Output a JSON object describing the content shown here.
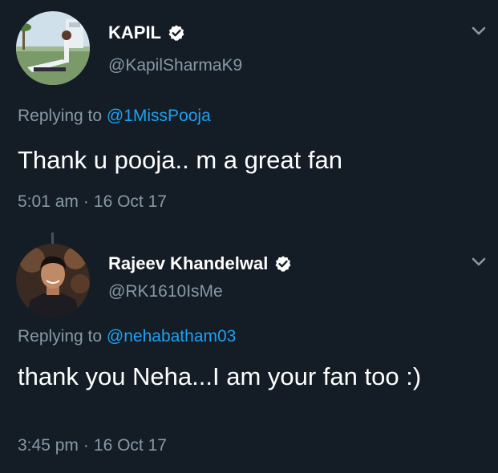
{
  "tweets": [
    {
      "display_name": "KAPIL",
      "verified": true,
      "handle": "@KapilSharmaK9",
      "replying_prefix": "Replying to",
      "replying_to": "@1MissPooja",
      "text": "Thank u pooja.. m a great fan",
      "time": "5:01 am",
      "separator": "·",
      "date": "16 Oct 17"
    },
    {
      "display_name": "Rajeev Khandelwal",
      "verified": true,
      "handle": "@RK1610IsMe",
      "replying_prefix": "Replying to",
      "replying_to": "@nehabatham03",
      "text": "thank you Neha...I am your fan too :)",
      "time": "3:45 pm",
      "separator": "·",
      "date": "16 Oct 17"
    }
  ],
  "colors": {
    "background": "#141d26",
    "primary_text": "#ffffff",
    "secondary_text": "#8899a6",
    "link": "#1da1f2"
  }
}
